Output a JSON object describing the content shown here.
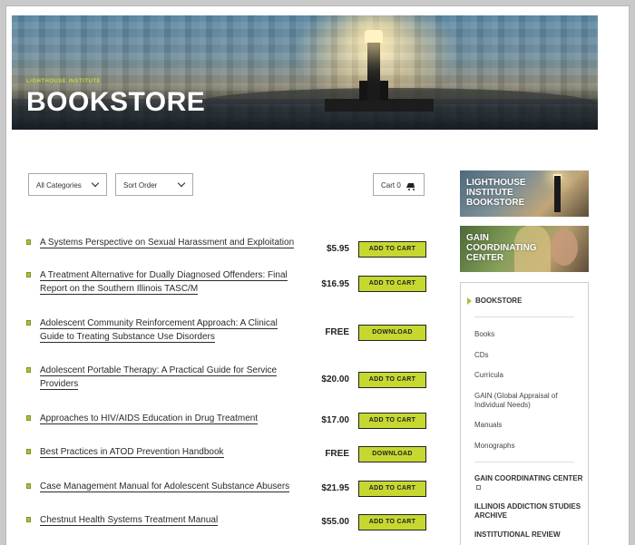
{
  "hero": {
    "kicker": "LIGHTHOUSE INSTITUTE",
    "title": "BOOKSTORE"
  },
  "filters": {
    "category": "All Categories",
    "sort": "Sort Order",
    "cart_label": "Cart 0"
  },
  "products": [
    {
      "title": "A Systems Perspective on Sexual Harassment and Exploitation",
      "price": "$5.95",
      "action": "ADD TO CART"
    },
    {
      "title": "A Treatment Alternative for Dually Diagnosed Offenders: Final Report on the Southern Illinois TASC/M",
      "price": "$16.95",
      "action": "ADD TO CART"
    },
    {
      "title": "Adolescent Community Reinforcement Approach: A Clinical Guide to Treating Substance Use Disorders",
      "price": "FREE",
      "action": "DOWNLOAD"
    },
    {
      "title": "Adolescent Portable Therapy: A Practical Guide for Service Providers",
      "price": "$20.00",
      "action": "ADD TO CART"
    },
    {
      "title": "Approaches to HIV/AIDS Education in Drug Treatment",
      "price": "$17.00",
      "action": "ADD TO CART"
    },
    {
      "title": "Best Practices in ATOD Prevention Handbook",
      "price": "FREE",
      "action": "DOWNLOAD"
    },
    {
      "title": "Case Management Manual for Adolescent Substance Abusers",
      "price": "$21.95",
      "action": "ADD TO CART"
    },
    {
      "title": "Chestnut Health Systems Treatment Manual",
      "price": "$55.00",
      "action": "ADD TO CART"
    }
  ],
  "sidebar": {
    "banner_lighthouse": "LIGHTHOUSE INSTITUTE BOOKSTORE",
    "banner_gain": "GAIN COORDINATING CENTER",
    "menu_head": "BOOKSTORE",
    "items": [
      "Books",
      "CDs",
      "Curricula",
      "GAIN (Global Appraisal of Individual Needs)",
      "Manuals",
      "Monographs"
    ],
    "links": [
      "GAIN COORDINATING CENTER",
      "ILLINOIS ADDICTION STUDIES ARCHIVE",
      "INSTITUTIONAL REVIEW"
    ]
  }
}
